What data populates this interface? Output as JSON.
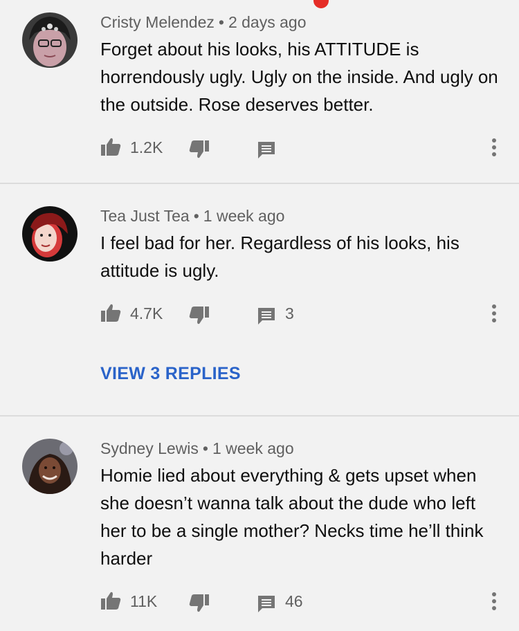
{
  "comments": [
    {
      "author": "Cristy Melendez",
      "time": "2 days ago",
      "text": "Forget about his looks, his ATTITUDE is horrendously ugly. Ugly on the inside. And ugly on the outside. Rose deserves better.",
      "likes": "1.2K",
      "replies_count": ""
    },
    {
      "author": "Tea Just Tea",
      "time": "1 week ago",
      "text": "I feel bad for her. Regardless of his looks, his attitude is ugly.",
      "likes": "4.7K",
      "replies_count": "3",
      "view_replies_label": "VIEW 3 REPLIES"
    },
    {
      "author": "Sydney Lewis",
      "time": "1 week ago",
      "text": "Homie lied about everything & gets upset when she doesn’t wanna talk about the dude who left her to be a single mother? Necks time he’ll think harder",
      "likes": "11K",
      "replies_count": "46"
    }
  ],
  "separator": "•",
  "icons": {
    "like": "thumbs-up-icon",
    "dislike": "thumbs-down-icon",
    "reply": "reply-comment-icon",
    "more": "more-vertical-icon"
  },
  "colors": {
    "accent_link": "#2a63c9",
    "notification": "#e52d27",
    "icon": "#757575"
  }
}
